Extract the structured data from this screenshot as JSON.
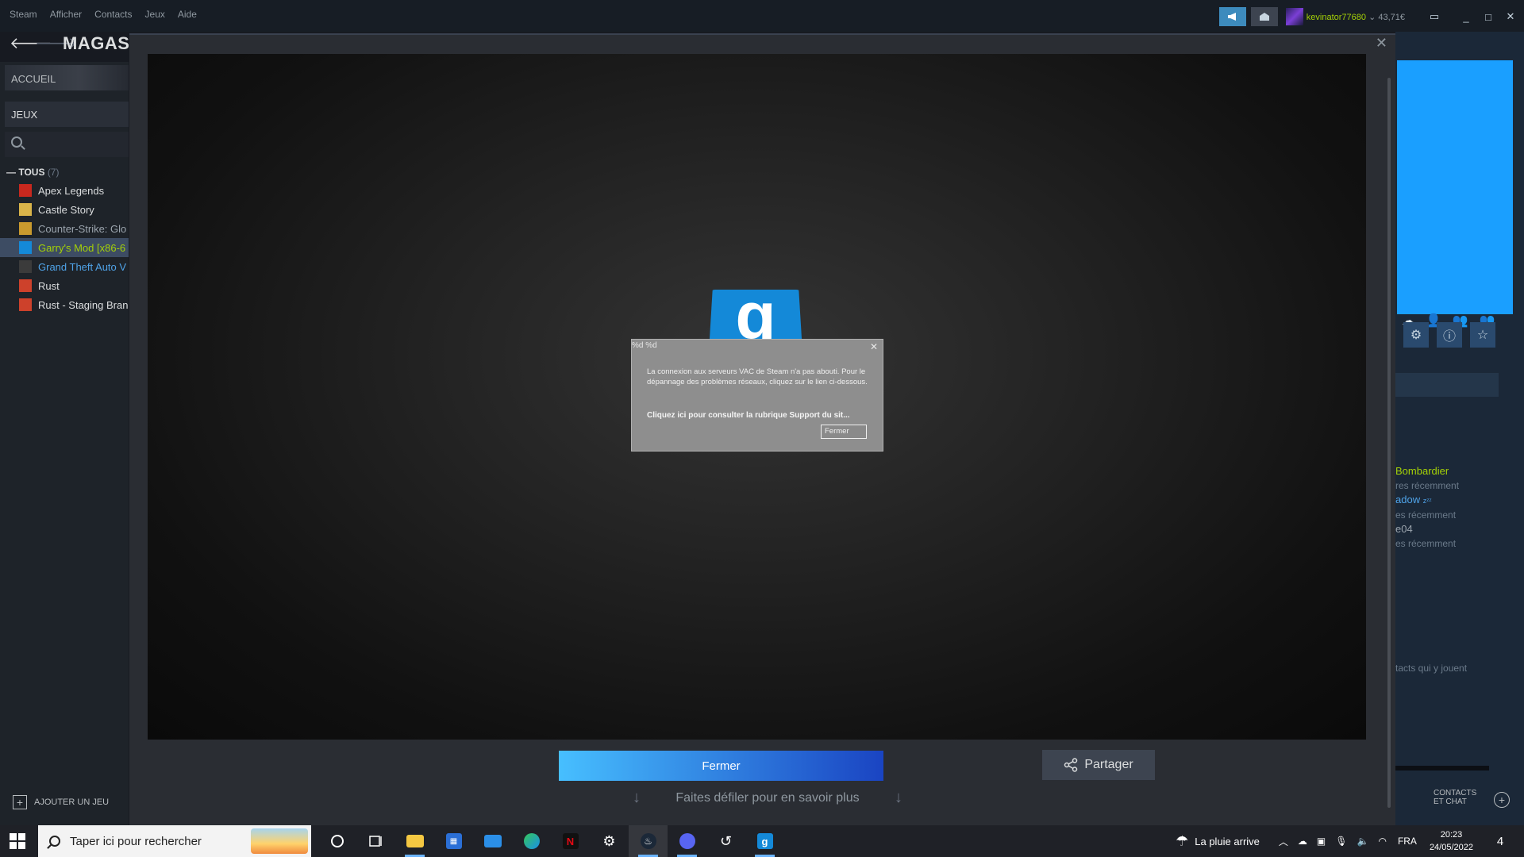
{
  "menu": [
    "Steam",
    "Afficher",
    "Contacts",
    "Jeux",
    "Aide"
  ],
  "account": {
    "username": "kevinator77680",
    "balance": "43,71€"
  },
  "nav": {
    "title": "MAGASI"
  },
  "sidebar": {
    "home_label": "ACCUEIL",
    "games_label": "JEUX",
    "category_label": "TOUS",
    "category_count": "(7)",
    "games": [
      {
        "name": "Apex Legends",
        "icon": "apex-icon",
        "color": "#c8281e",
        "state": "normal"
      },
      {
        "name": "Castle Story",
        "icon": "castle-story-icon",
        "color": "#d9b44a",
        "state": "normal"
      },
      {
        "name": "Counter-Strike: Glo",
        "icon": "csgo-icon",
        "color": "#c99a2e",
        "state": "dim"
      },
      {
        "name": "Garry's Mod [x86-6",
        "icon": "gmod-icon",
        "color": "#1489d8",
        "state": "selected"
      },
      {
        "name": "Grand Theft Auto V",
        "icon": "gta-icon",
        "color": "#3b3b3b",
        "state": "update"
      },
      {
        "name": "Rust",
        "icon": "rust-icon",
        "color": "#cd412b",
        "state": "normal"
      },
      {
        "name": "Rust - Staging Bran",
        "icon": "rust-icon",
        "color": "#cd412b",
        "state": "normal"
      }
    ],
    "add_game_label": "AJOUTER UN JEU"
  },
  "right_panel": {
    "friends": [
      {
        "name": "Bombardier",
        "status": "res récemment"
      },
      {
        "name": "adow",
        "status": "es récemment",
        "suffix": "zᶻᶻ"
      },
      {
        "name": "e04",
        "status": "es récemment"
      }
    ],
    "playing_text": "tacts qui y jouent",
    "contacts_chat": [
      "CONTACTS",
      "ET CHAT"
    ]
  },
  "modal": {
    "close_symbol": "✕",
    "fermer_label": "Fermer",
    "share_label": "Partager",
    "scroll_hint": "Faites défiler pour en savoir plus",
    "logo_letter": "g"
  },
  "vac_dialog": {
    "title": "%d %d",
    "message": "La connexion aux serveurs VAC de Steam n'a pas abouti. Pour le dépannage des problèmes réseaux, cliquez sur le lien ci-dessous.",
    "link": "Cliquez ici pour consulter la rubrique Support du sit...",
    "close_button": "Fermer"
  },
  "taskbar": {
    "search_placeholder": "Taper ici pour rechercher",
    "weather": "La pluie arrive",
    "language": "FRA",
    "time": "20:23",
    "date": "24/05/2022",
    "notification_count": "4"
  }
}
